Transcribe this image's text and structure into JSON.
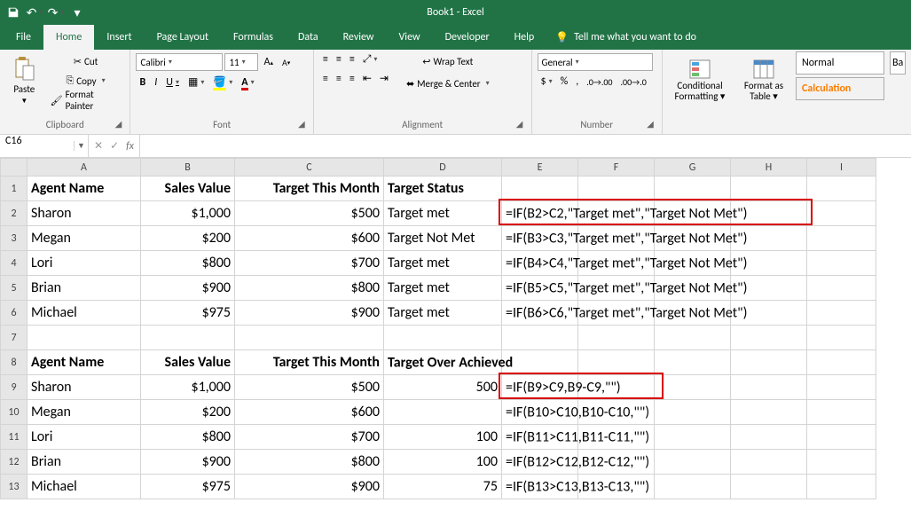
{
  "app": {
    "title": "Book1 - Excel"
  },
  "tabs": [
    "File",
    "Home",
    "Insert",
    "Page Layout",
    "Formulas",
    "Data",
    "Review",
    "View",
    "Developer",
    "Help"
  ],
  "activeTab": "Home",
  "tellMe": "Tell me what you want to do",
  "ribbon": {
    "clipboard": {
      "paste": "Paste",
      "cut": "Cut",
      "copy": "Copy",
      "fmtPainter": "Format Painter",
      "label": "Clipboard"
    },
    "font": {
      "name": "Calibri",
      "size": "11",
      "bold": "B",
      "italic": "I",
      "underline": "U",
      "label": "Font"
    },
    "alignment": {
      "wrap": "Wrap Text",
      "merge": "Merge & Center",
      "label": "Alignment"
    },
    "number": {
      "format": "General",
      "label": "Number"
    },
    "styles": {
      "cond": "Conditional Formatting",
      "as_table": "Format as Table",
      "normal": "Normal",
      "calc": "Calculation",
      "ba": "Ba"
    }
  },
  "nameBox": "C16",
  "headers": [
    "A",
    "B",
    "C",
    "D",
    "E",
    "F",
    "G",
    "H",
    "I"
  ],
  "rows": [
    {
      "n": 1,
      "A": "Agent Name",
      "B": "Sales Value",
      "C": "Target This Month",
      "D": "Target Status",
      "bold": true
    },
    {
      "n": 2,
      "A": "Sharon",
      "B": "$1,000",
      "C": "$500",
      "D": "Target met",
      "E": "=IF(B2>C2,\"Target met\",\"Target Not Met\")"
    },
    {
      "n": 3,
      "A": "Megan",
      "B": "$200",
      "C": "$600",
      "D": "Target Not Met",
      "E": "=IF(B3>C3,\"Target met\",\"Target Not Met\")"
    },
    {
      "n": 4,
      "A": "Lori",
      "B": "$800",
      "C": "$700",
      "D": "Target met",
      "E": "=IF(B4>C4,\"Target met\",\"Target Not Met\")"
    },
    {
      "n": 5,
      "A": "Brian",
      "B": "$900",
      "C": "$800",
      "D": "Target met",
      "E": "=IF(B5>C5,\"Target met\",\"Target Not Met\")"
    },
    {
      "n": 6,
      "A": "Michael",
      "B": "$975",
      "C": "$900",
      "D": "Target met",
      "E": "=IF(B6>C6,\"Target met\",\"Target Not Met\")"
    },
    {
      "n": 7
    },
    {
      "n": 8,
      "A": "Agent Name",
      "B": "Sales Value",
      "C": "Target This Month",
      "D": "Target Over Achieved",
      "bold": true
    },
    {
      "n": 9,
      "A": "Sharon",
      "B": "$1,000",
      "C": "$500",
      "D": "500",
      "E": "=IF(B9>C9,B9-C9,\"\")",
      "Dright": true
    },
    {
      "n": 10,
      "A": "Megan",
      "B": "$200",
      "C": "$600",
      "D": "",
      "E": "=IF(B10>C10,B10-C10,\"\")"
    },
    {
      "n": 11,
      "A": "Lori",
      "B": "$800",
      "C": "$700",
      "D": "100",
      "E": "=IF(B11>C11,B11-C11,\"\")",
      "Dright": true
    },
    {
      "n": 12,
      "A": "Brian",
      "B": "$900",
      "C": "$800",
      "D": "100",
      "E": "=IF(B12>C12,B12-C12,\"\")",
      "Dright": true
    },
    {
      "n": 13,
      "A": "Michael",
      "B": "$975",
      "C": "$900",
      "D": "75",
      "E": "=IF(B13>C13,B13-C13,\"\")",
      "Dright": true
    }
  ]
}
